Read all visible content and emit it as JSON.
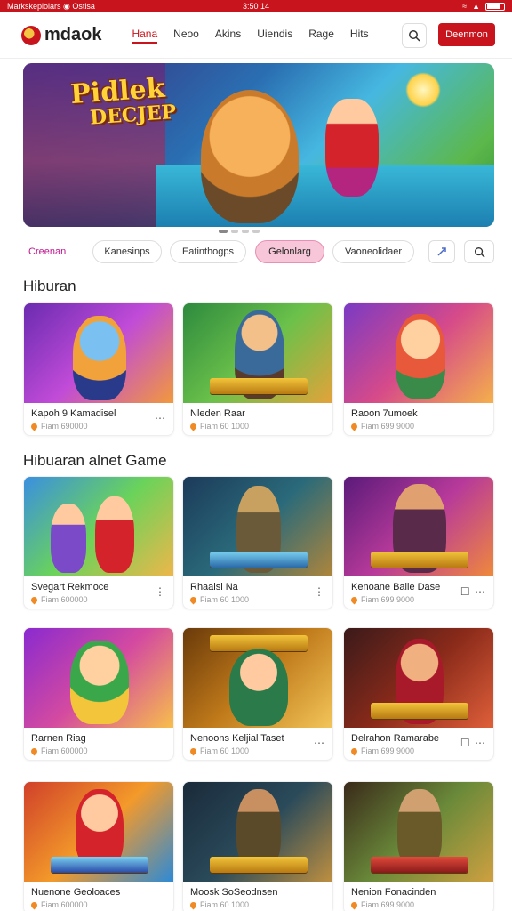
{
  "status_bar": {
    "left": "Markskeplolars",
    "carrier": "Ostisa",
    "time": "3:50 14"
  },
  "header": {
    "logo_text": "mdaok",
    "nav": [
      "Hana",
      "Neoo",
      "Akins",
      "Uiendis",
      "Rage",
      "Hits"
    ],
    "active_nav_index": 0,
    "cta_label": "Deenmon"
  },
  "hero": {
    "title_line1": "Pidlek",
    "title_line2": "DECJEP",
    "slides": 4,
    "active_slide": 1
  },
  "chips": [
    "Creenan",
    "Kanesinps",
    "Eatinthogps",
    "Gelonlarg",
    "Vaoneolidaer"
  ],
  "active_chip_index": 3,
  "sections": [
    {
      "title": "Hiburan",
      "games": [
        {
          "name": "Kapoh 9 Kamadisel",
          "meta": "Fiam 690000"
        },
        {
          "name": "Nleden Raar",
          "meta": "Fiam 60 1000"
        },
        {
          "name": "Raoon 7umoek",
          "meta": "Fiam 699 9000"
        }
      ]
    },
    {
      "title": "Hibuaran alnet Game",
      "games": [
        {
          "name": "Svegart Rekmoce",
          "meta": "Fiam 600000"
        },
        {
          "name": "Rhaalsl Na",
          "meta": "Fiam 60 1000"
        },
        {
          "name": "Kenoane Baile Dase",
          "meta": "Fiam 699 9000"
        },
        {
          "name": "Rarnen Riag",
          "meta": "Fiam 600000"
        },
        {
          "name": "Nenoons Keljial Taset",
          "meta": "Fiam 60 1000"
        },
        {
          "name": "Delrahon Ramarabe",
          "meta": "Fiam 699 9000"
        },
        {
          "name": "Nuenone Geoloaces",
          "meta": "Fiam 600000"
        },
        {
          "name": "Moosk SoSeodnsen",
          "meta": "Fiam 60 1000"
        },
        {
          "name": "Nenion Fonacinden",
          "meta": "Fiam 699 9000"
        }
      ]
    }
  ],
  "colors": {
    "brand": "#c8141c",
    "chip_active": "#f7c6d8"
  }
}
